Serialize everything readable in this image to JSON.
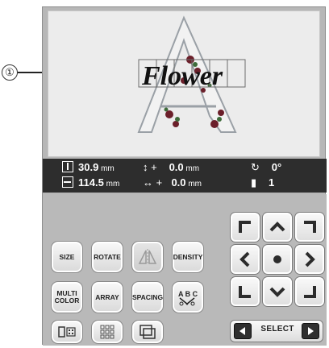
{
  "callout": {
    "number": "①"
  },
  "preview": {
    "text": "Flower",
    "letter": "A"
  },
  "info": {
    "height_value": "30.9",
    "height_unit": "mm",
    "width_value": "114.5",
    "width_unit": "mm",
    "offset_y_value": "0.0",
    "offset_y_unit": "mm",
    "offset_x_value": "0.0",
    "offset_x_unit": "mm",
    "rotation_value": "0°",
    "thread_count": "1"
  },
  "buttons": {
    "size": "SIZE",
    "rotate": "ROTATE",
    "density": "DENSITY",
    "multi_color_line1": "MULTI",
    "multi_color_line2": "COLOR",
    "array": "ARRAY",
    "spacing": "SPACING"
  },
  "select": {
    "label": "SELECT"
  },
  "icons": [
    "mirror-icon",
    "check-spelling-icon",
    "thread-spool-icon",
    "grid-icon",
    "border-icon",
    "arrow-up-icon",
    "arrow-down-icon",
    "arrow-left-icon",
    "arrow-right-icon",
    "center-dot-icon",
    "corner-top-left-icon",
    "corner-top-right-icon",
    "corner-bottom-left-icon",
    "corner-bottom-right-icon"
  ]
}
